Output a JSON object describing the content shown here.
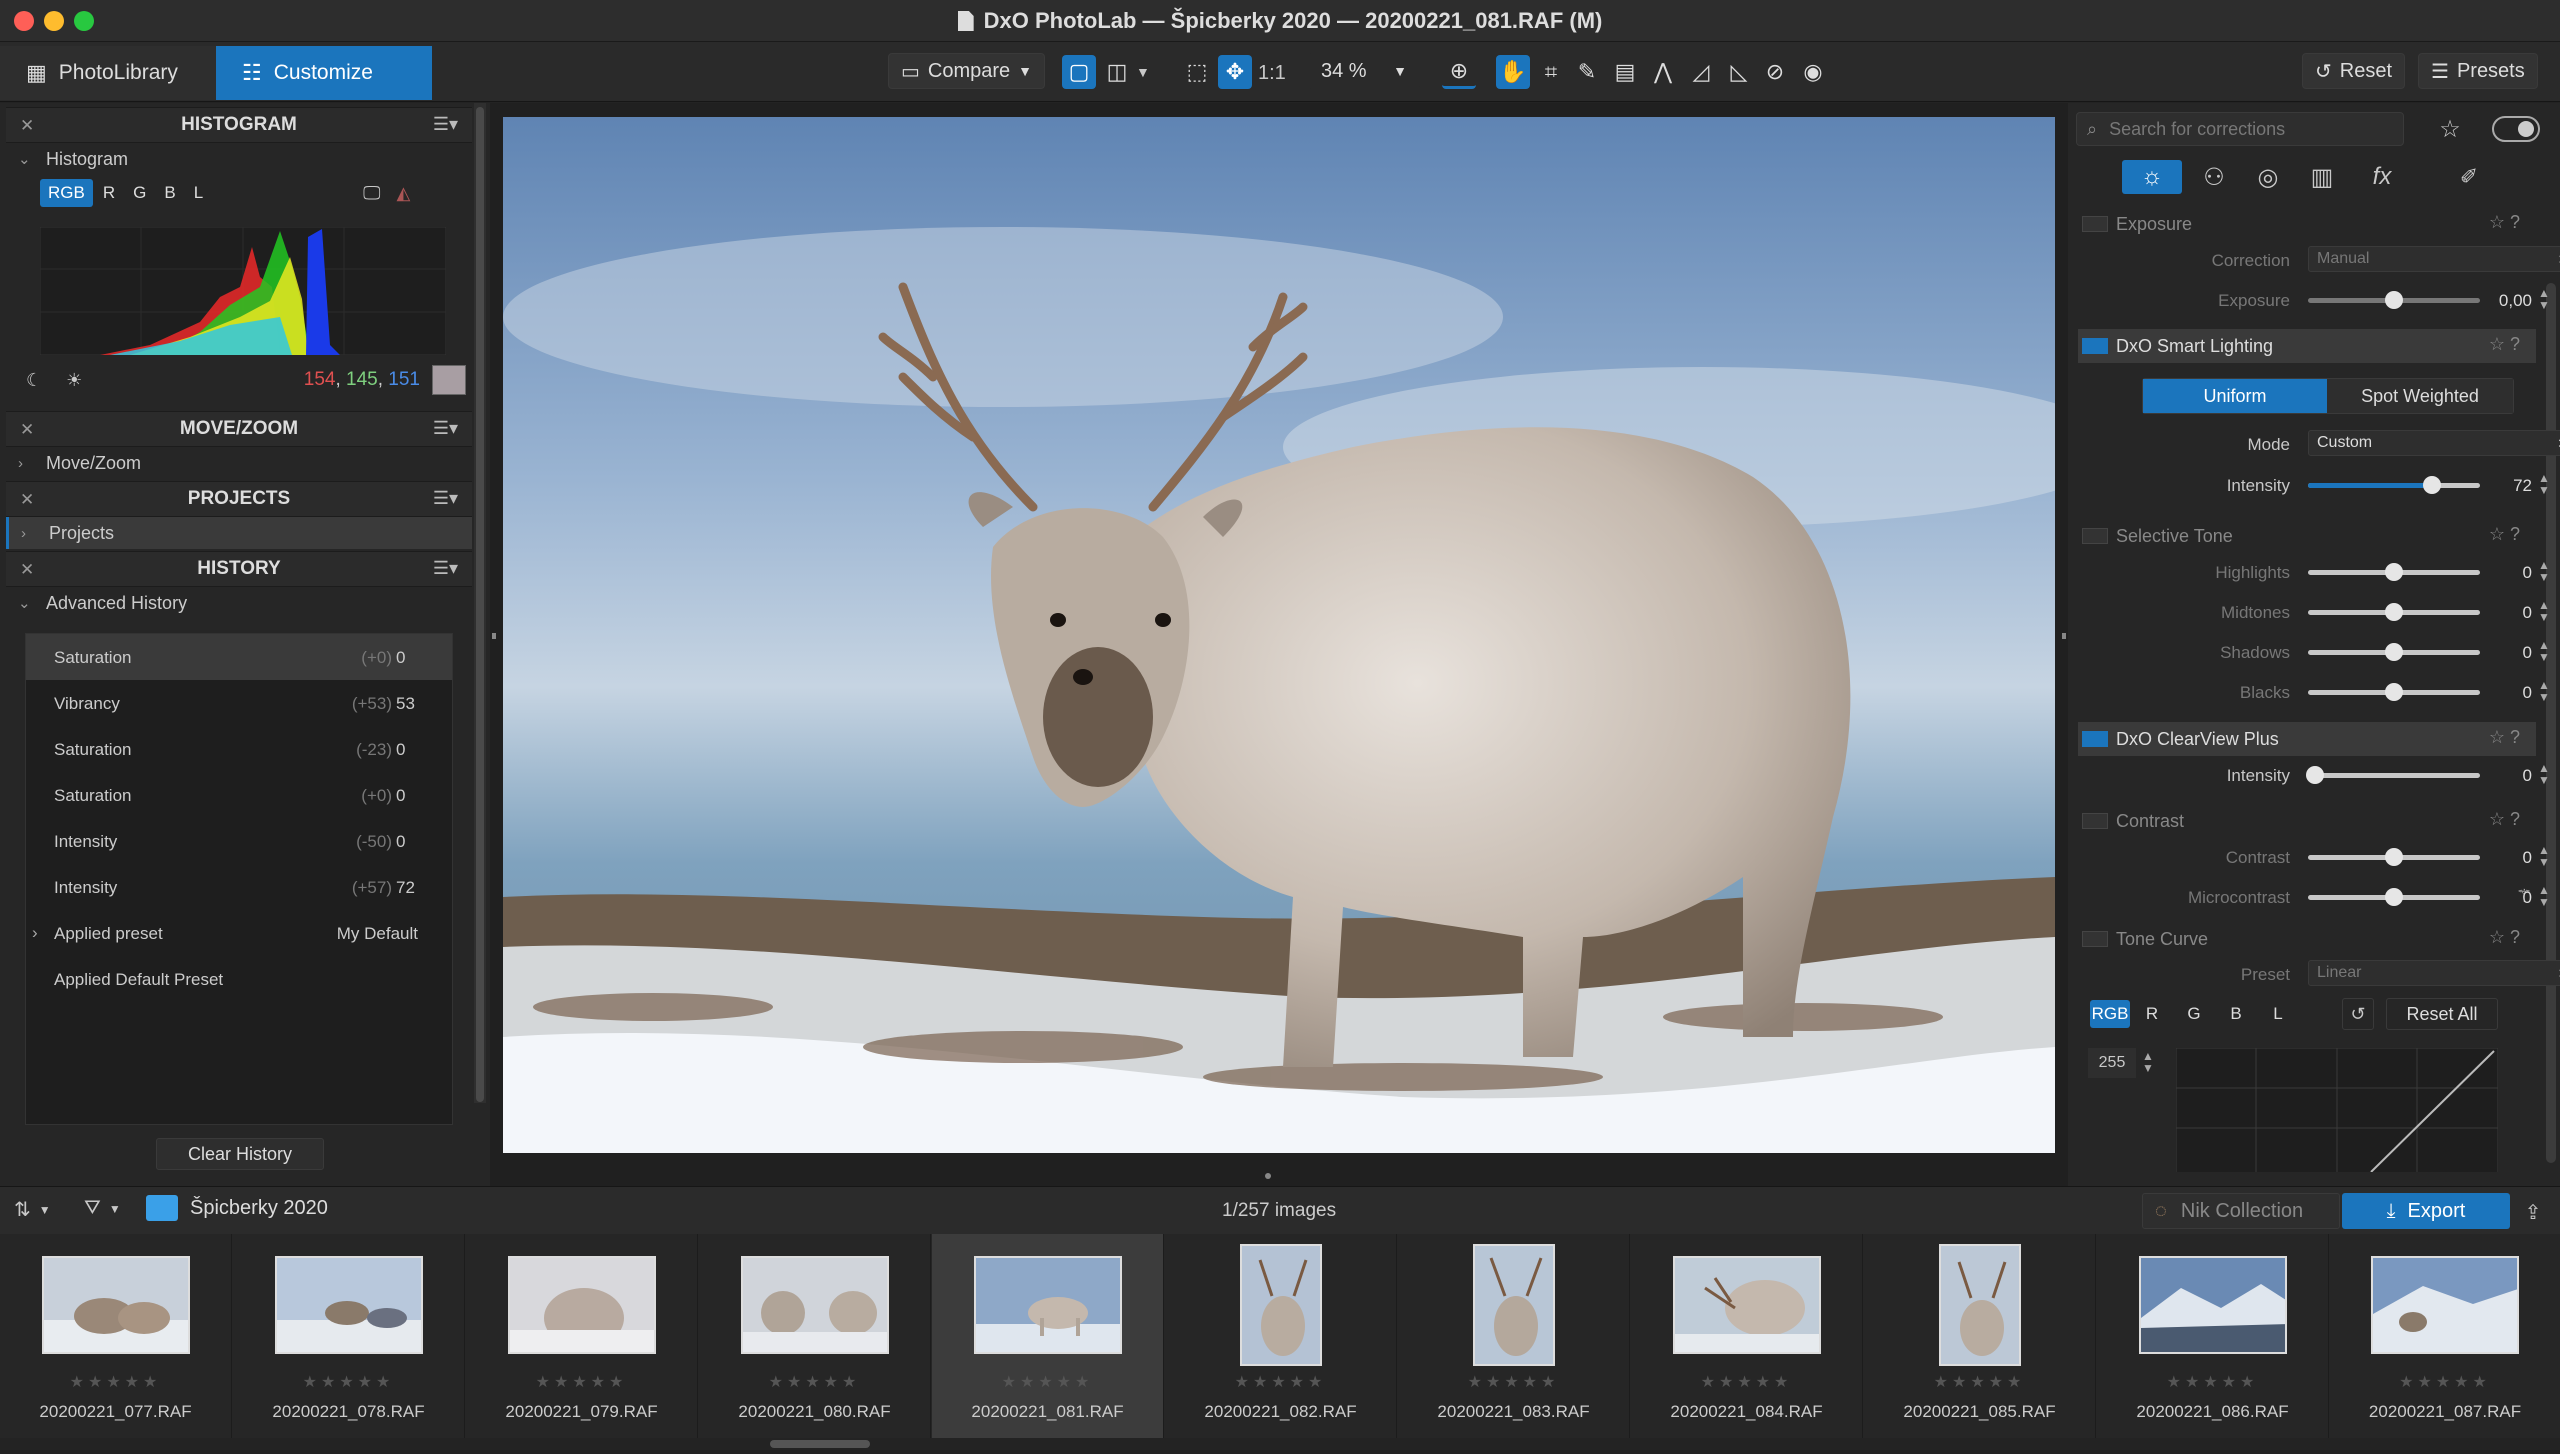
{
  "window": {
    "title": "DxO PhotoLab — Špicberky 2020 — 20200221_081.RAF (M)"
  },
  "tabs": {
    "photolibrary": "PhotoLibrary",
    "customize": "Customize"
  },
  "toolbar": {
    "compare": "Compare",
    "one_to_one": "1:1",
    "zoom": "34 %",
    "reset": "Reset",
    "presets": "Presets"
  },
  "histogram_panel": {
    "header": "HISTOGRAM",
    "subtitle": "Histogram",
    "channels": [
      "RGB",
      "R",
      "G",
      "B",
      "L"
    ],
    "readout": {
      "r": "154",
      "g": "145",
      "b": "151",
      "sep": ", "
    },
    "swatch_color": "#a89ea3"
  },
  "movezoom_panel": {
    "header": "MOVE/ZOOM",
    "item": "Move/Zoom"
  },
  "projects_panel": {
    "header": "PROJECTS",
    "item": "Projects"
  },
  "history_panel": {
    "header": "HISTORY",
    "subtitle": "Advanced History",
    "items": [
      {
        "name": "Saturation",
        "delta": "(+0)",
        "value": "0"
      },
      {
        "name": "Vibrancy",
        "delta": "(+53)",
        "value": "53"
      },
      {
        "name": "Saturation",
        "delta": "(-23)",
        "value": "0"
      },
      {
        "name": "Saturation",
        "delta": "(+0)",
        "value": "0"
      },
      {
        "name": "Intensity",
        "delta": "(-50)",
        "value": "0"
      },
      {
        "name": "Intensity",
        "delta": "(+57)",
        "value": "72"
      },
      {
        "name": "Applied preset",
        "delta": "",
        "value": "My Default"
      },
      {
        "name": "Applied Default Preset",
        "delta": "",
        "value": ""
      }
    ],
    "clear": "Clear History"
  },
  "corrections": {
    "search_placeholder": "Search for corrections",
    "exposure": {
      "title": "Exposure",
      "correction_label": "Correction",
      "correction_value": "Manual",
      "exposure_label": "Exposure",
      "exposure_value": "0,00",
      "exposure_level": 0.5
    },
    "smart_lighting": {
      "title": "DxO Smart Lighting",
      "uniform": "Uniform",
      "spot": "Spot Weighted",
      "mode_label": "Mode",
      "mode_value": "Custom",
      "intensity_label": "Intensity",
      "intensity_value": "72",
      "intensity_level": 0.72
    },
    "selective_tone": {
      "title": "Selective Tone",
      "rows": [
        {
          "label": "Highlights",
          "value": "0"
        },
        {
          "label": "Midtones",
          "value": "0"
        },
        {
          "label": "Shadows",
          "value": "0"
        },
        {
          "label": "Blacks",
          "value": "0"
        }
      ]
    },
    "clearview": {
      "title": "DxO ClearView Plus",
      "intensity_label": "Intensity",
      "intensity_value": "0"
    },
    "contrast": {
      "title": "Contrast",
      "rows": [
        {
          "label": "Contrast",
          "value": "0"
        },
        {
          "label": "Microcontrast",
          "value": "0"
        }
      ]
    },
    "tone_curve": {
      "title": "Tone Curve",
      "preset_label": "Preset",
      "preset_value": "Linear",
      "channels": [
        "RGB",
        "R",
        "G",
        "B",
        "L"
      ],
      "reset_all": "Reset All",
      "value": "255"
    }
  },
  "filmstrip": {
    "folder": "Špicberky 2020",
    "count": "1/257 images",
    "nik": "Nik Collection",
    "export": "Export",
    "stars": "★★★★★",
    "files": [
      "20200221_077.RAF",
      "20200221_078.RAF",
      "20200221_079.RAF",
      "20200221_080.RAF",
      "20200221_081.RAF",
      "20200221_082.RAF",
      "20200221_083.RAF",
      "20200221_084.RAF",
      "20200221_085.RAF",
      "20200221_086.RAF",
      "20200221_087.RAF"
    ]
  },
  "colors": {
    "accent": "#1b75bd",
    "hist_red": "#e05050",
    "hist_green": "#7fd07f",
    "hist_blue": "#4a8ce8"
  }
}
